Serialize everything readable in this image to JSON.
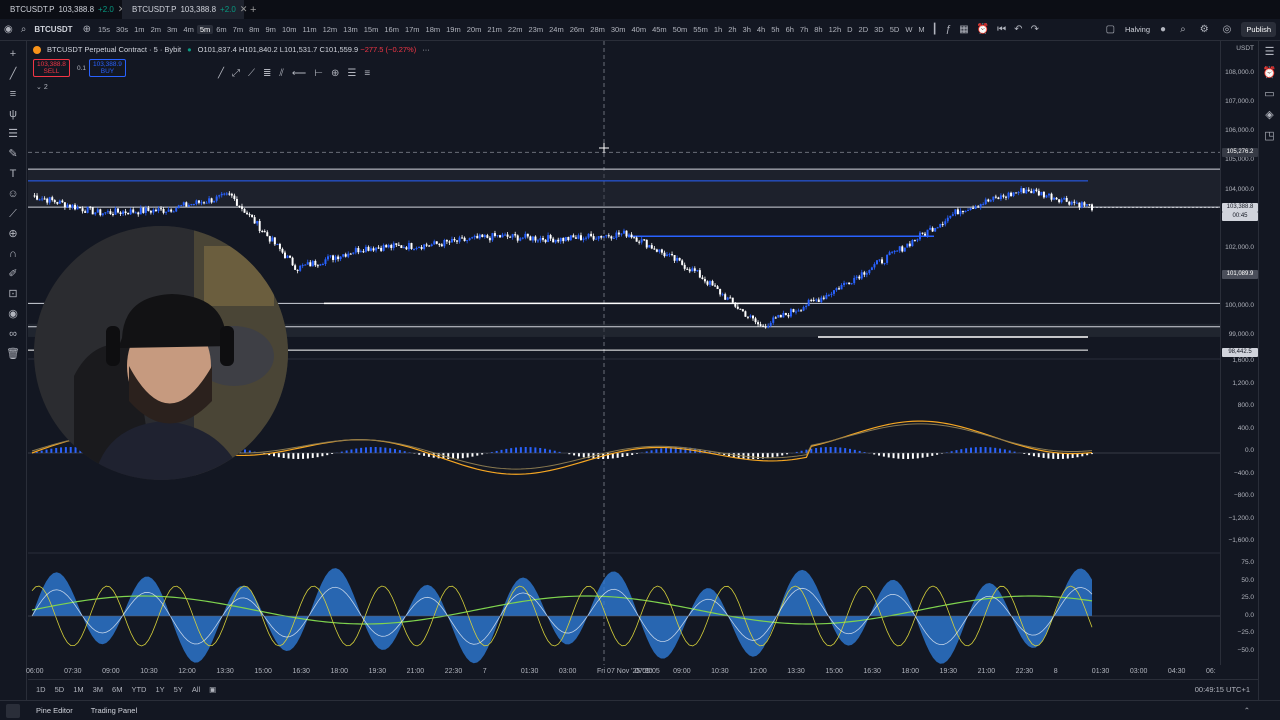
{
  "tabs": [
    {
      "symbol": "BTCUSDT.P",
      "price": "103,388.8",
      "change": "+2.0",
      "active": false
    },
    {
      "symbol": "BTCUSDT.P",
      "price": "103,388.8",
      "change": "+2.0",
      "active": true
    }
  ],
  "toolbar": {
    "symbol": "BTCUSDT",
    "timeframes": [
      "15s",
      "30s",
      "1m",
      "2m",
      "3m",
      "4m",
      "5m",
      "6m",
      "7m",
      "8m",
      "9m",
      "10m",
      "11m",
      "12m",
      "13m",
      "15m",
      "16m",
      "17m",
      "18m",
      "19m",
      "20m",
      "21m",
      "22m",
      "23m",
      "24m",
      "26m",
      "28m",
      "30m",
      "40m",
      "45m",
      "50m",
      "55m",
      "1h",
      "2h",
      "3h",
      "4h",
      "5h",
      "6h",
      "7h",
      "8h",
      "12h",
      "D",
      "2D",
      "3D",
      "5D",
      "W",
      "M"
    ],
    "selected_timeframe": "5m",
    "halving_label": "Halving",
    "publish_label": "Publish"
  },
  "legend": {
    "title": "BTCUSDT Perpetual Contract · 5 · Bybit",
    "open": "O101,837.4",
    "high": "H101,840.2",
    "low": "L101,531.7",
    "close": "C101,559.9",
    "change": "−277.5 (−0.27%)"
  },
  "trade": {
    "sell_price": "103,388.8",
    "sell_label": "SELL",
    "qty": "0.1",
    "buy_price": "103,388.9",
    "buy_label": "BUY",
    "layers": "2"
  },
  "price_axis": {
    "currency": "USDT",
    "main_labels": [
      "108,000.0",
      "107,000.0",
      "106,000.0",
      "105,000.0",
      "104,000.0",
      "102,000.0",
      "100,000.0",
      "99,000.0"
    ],
    "crosshair_price": "105,276.2",
    "last_price": "103,388.8",
    "countdown": "00:45",
    "alert_price": "101,089.9",
    "low_tag": "98,442.5",
    "osc1_labels": [
      "1,600.0",
      "1,200.0",
      "800.0",
      "400.0",
      "0.0",
      "−400.0",
      "−800.0",
      "−1,200.0",
      "−1,600.0"
    ],
    "osc2_labels": [
      "75.0",
      "50.0",
      "25.0",
      "0.0",
      "−25.0",
      "−50.0"
    ]
  },
  "time_axis": [
    "06:00",
    "07:30",
    "09:00",
    "10:30",
    "12:00",
    "13:30",
    "15:00",
    "16:30",
    "18:00",
    "19:30",
    "21:00",
    "22:30",
    "7",
    "01:30",
    "03:00",
    "Fri 07 Nov '25  05:05",
    "07:30",
    "09:00",
    "10:30",
    "12:00",
    "13:30",
    "15:00",
    "16:30",
    "18:00",
    "19:30",
    "21:00",
    "22:30",
    "8",
    "01:30",
    "03:00",
    "04:30",
    "06:"
  ],
  "range_bar": {
    "ranges": [
      "1D",
      "5D",
      "1M",
      "3M",
      "6M",
      "YTD",
      "1Y",
      "5Y",
      "All"
    ],
    "clock": "00:49:15 UTC+1"
  },
  "footer": {
    "pine_editor": "Pine Editor",
    "trading_panel": "Trading Panel"
  },
  "colors": {
    "background": "#131722",
    "candle_up": "#2962ff",
    "candle_down": "#ffffff",
    "macd_signal": "#f5a623",
    "osc_fill": "#2e7bd6",
    "osc_green": "#7fd44e"
  },
  "chart_data": {
    "type": "line",
    "title": "BTCUSDT Perpetual Contract · 5 · Bybit",
    "x": [
      "06:00",
      "09:00",
      "12:00",
      "15:00",
      "18:00",
      "21:00",
      "7",
      "03:00",
      "05:05",
      "09:00",
      "12:00",
      "13:30",
      "15:00",
      "18:00",
      "21:00",
      "22:30",
      "8"
    ],
    "series": [
      {
        "name": "",
        "values": [
          103800,
          103200,
          103300,
          103800,
          101300,
          102000,
          102100,
          102400,
          102300,
          102500,
          101200,
          99300,
          100400,
          101800,
          103300,
          104000,
          103400
        ]
      }
    ],
    "ylim": [
      98400,
      108200
    ],
    "levels": [
      104700,
      103400,
      100100,
      99300
    ]
  }
}
